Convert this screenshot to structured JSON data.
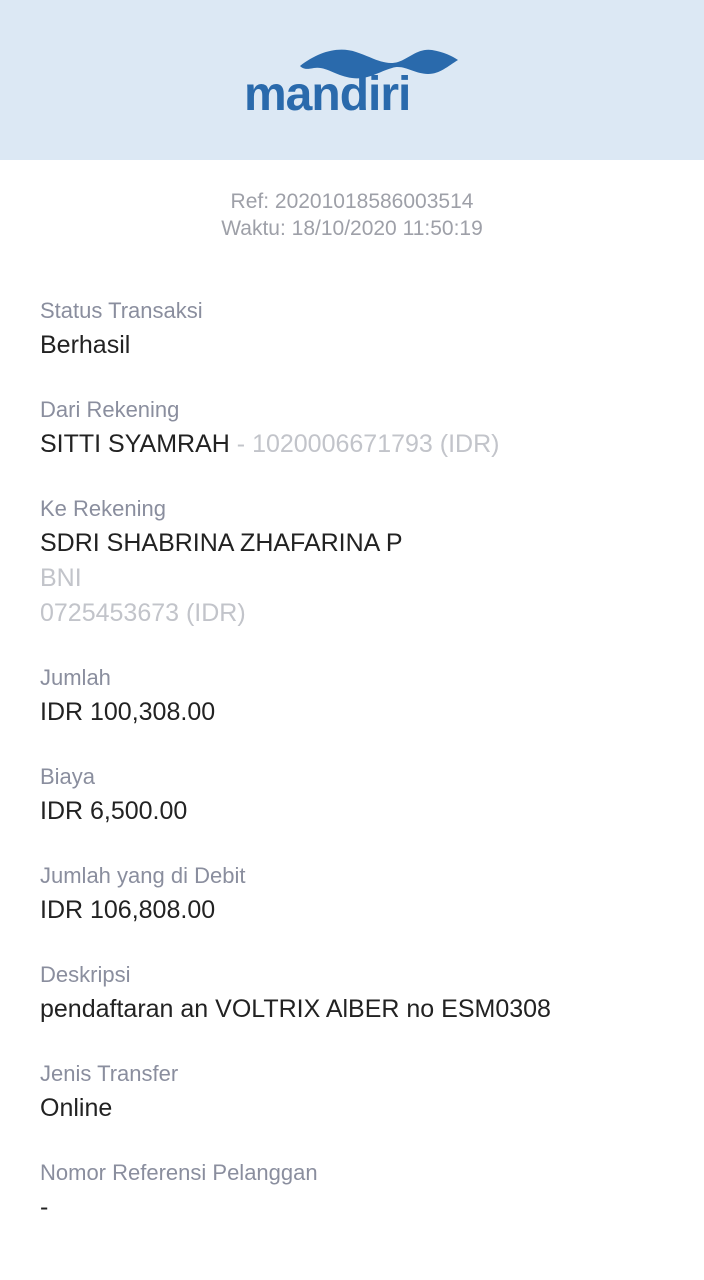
{
  "header": {
    "logo_text": "mandiri",
    "brand_color": "#2a6aac",
    "background": "#dce8f4"
  },
  "reference": {
    "ref_line": "Ref: 20201018586003514",
    "time_line": "Waktu: 18/10/2020 11:50:19"
  },
  "fields": {
    "status": {
      "label": "Status Transaksi",
      "value": "Berhasil"
    },
    "from_account": {
      "label": "Dari Rekening",
      "name": "SITTI SYAMRAH",
      "separator": " - ",
      "number": "1020006671793 (IDR)"
    },
    "to_account": {
      "label": "Ke Rekening",
      "name": "SDRI SHABRINA ZHAFARINA P",
      "bank": "BNI",
      "number": "0725453673 (IDR)"
    },
    "amount": {
      "label": "Jumlah",
      "value": "IDR 100,308.00"
    },
    "fee": {
      "label": "Biaya",
      "value": "IDR 6,500.00"
    },
    "debited": {
      "label": "Jumlah yang di Debit",
      "value": "IDR 106,808.00"
    },
    "description": {
      "label": "Deskripsi",
      "value": "pendaftaran an VOLTRIX AlBER no ESM0308"
    },
    "transfer_type": {
      "label": "Jenis Transfer",
      "value": "Online"
    },
    "customer_ref": {
      "label": "Nomor Referensi Pelanggan",
      "value": "-"
    }
  }
}
